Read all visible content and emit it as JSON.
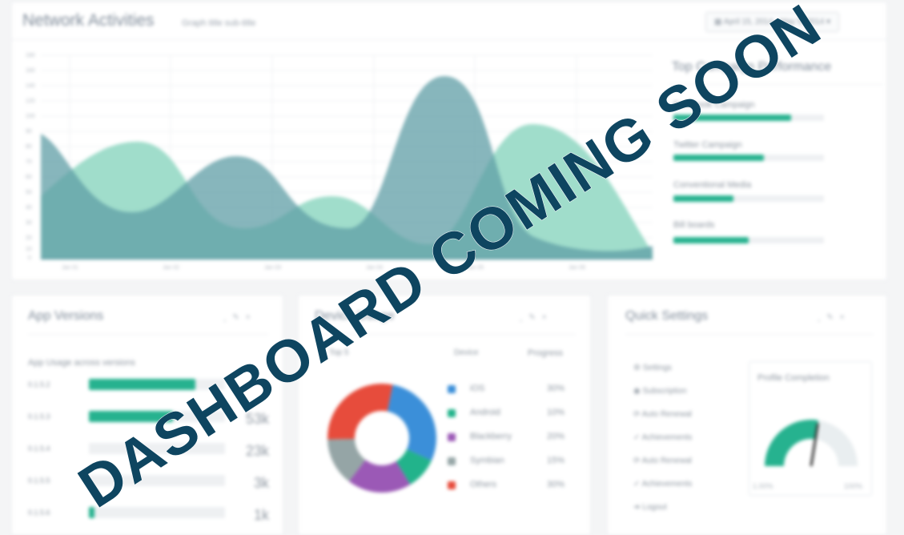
{
  "header": {
    "title": "Network Activities",
    "subtitle": "Graph title sub-title",
    "date_range": "April 15, 2014 - May 5, 2014",
    "date_icon": "calendar-icon"
  },
  "network_chart": {
    "y_ticks": [
      "180",
      "160",
      "140",
      "120",
      "100",
      "90",
      "80",
      "70",
      "60",
      "50",
      "40",
      "30",
      "20",
      "10",
      "0"
    ],
    "x_ticks": [
      "Jan 01",
      "Jan 02",
      "Jan 03",
      "Jan 04",
      "Jan 05",
      "Jan 06"
    ]
  },
  "top_campaign": {
    "title": "Top Campaign Performance",
    "items": [
      {
        "label": "Facebook Campaign",
        "fraction": 0.78
      },
      {
        "label": "Twitter Campaign",
        "fraction": 0.6
      },
      {
        "label": "Conventional Media",
        "fraction": 0.4
      },
      {
        "label": "Bill boards",
        "fraction": 0.5
      }
    ]
  },
  "app_versions": {
    "title": "App Versions",
    "subtitle": "App Usage across versions",
    "rows": [
      {
        "label": "0.1.5.2",
        "value": "",
        "fraction": 0.78
      },
      {
        "label": "0.1.5.3",
        "value": "53k",
        "fraction": 0.62
      },
      {
        "label": "0.1.5.4",
        "value": "23k",
        "fraction": 0.0
      },
      {
        "label": "0.1.5.5",
        "value": "3k",
        "fraction": 0.0
      },
      {
        "label": "0.1.5.6",
        "value": "1k",
        "fraction": 0.04
      }
    ]
  },
  "device_usage": {
    "title": "Device Usage",
    "col_top": "Top 5",
    "col_device": "Device",
    "col_progress": "Progress",
    "items": [
      {
        "name": "iOS",
        "pct": "30%",
        "value": 30,
        "color": "#3b8fd9"
      },
      {
        "name": "Android",
        "pct": "10%",
        "value": 10,
        "color": "#22b38b"
      },
      {
        "name": "Blackberry",
        "pct": "20%",
        "value": 20,
        "color": "#9b59b6"
      },
      {
        "name": "Symbian",
        "pct": "15%",
        "value": 15,
        "color": "#95a5a6"
      },
      {
        "name": "Others",
        "pct": "30%",
        "value": 30,
        "color": "#e74c3c"
      }
    ]
  },
  "quick_settings": {
    "title": "Quick Settings",
    "items": [
      {
        "label": "Settings",
        "icon": "gear-icon"
      },
      {
        "label": "Subscription",
        "icon": "circle-icon"
      },
      {
        "label": "Auto Renewal",
        "icon": "refresh-icon"
      },
      {
        "label": "Achievements",
        "icon": "trophy-icon"
      },
      {
        "label": "Auto Renewal",
        "icon": "refresh-icon"
      },
      {
        "label": "Achievements",
        "icon": "trophy-icon"
      },
      {
        "label": "Logout",
        "icon": "logout-icon"
      }
    ],
    "profile": {
      "title": "Profile Completion",
      "min_label": "1.00%",
      "max_label": "100%",
      "value": 0.55
    }
  },
  "overlay": {
    "text": "DASHBOARD COMING SOON",
    "color": "#0e4560"
  }
}
